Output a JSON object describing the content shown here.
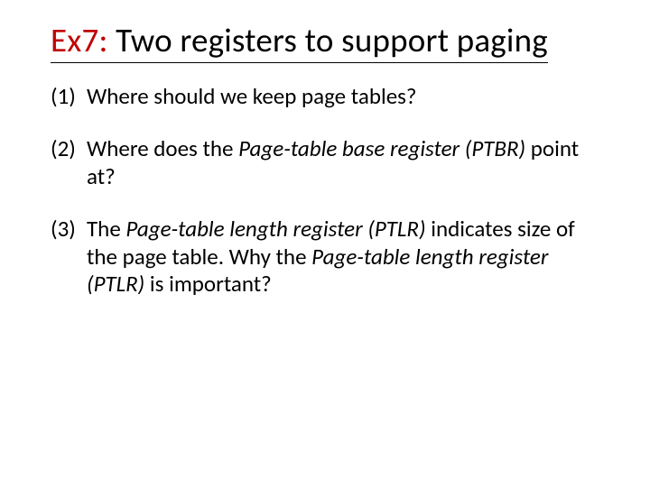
{
  "title": {
    "prefix": "Ex7:",
    "rest": " Two registers to support paging"
  },
  "items": [
    {
      "num": "(1)",
      "parts": [
        {
          "t": "Where should we keep page tables?",
          "i": false
        }
      ]
    },
    {
      "num": "(2)",
      "parts": [
        {
          "t": "Where does the ",
          "i": false
        },
        {
          "t": "Page-table base register (PTBR)",
          "i": true
        },
        {
          "t": " point at?",
          "i": false
        }
      ]
    },
    {
      "num": "(3)",
      "parts": [
        {
          "t": "The ",
          "i": false
        },
        {
          "t": "Page-table length register (PTLR)",
          "i": true
        },
        {
          "t": " indicates size of the page table. Why the ",
          "i": false
        },
        {
          "t": "Page-table length register (PTLR)",
          "i": true
        },
        {
          "t": " is important?",
          "i": false
        }
      ]
    }
  ]
}
